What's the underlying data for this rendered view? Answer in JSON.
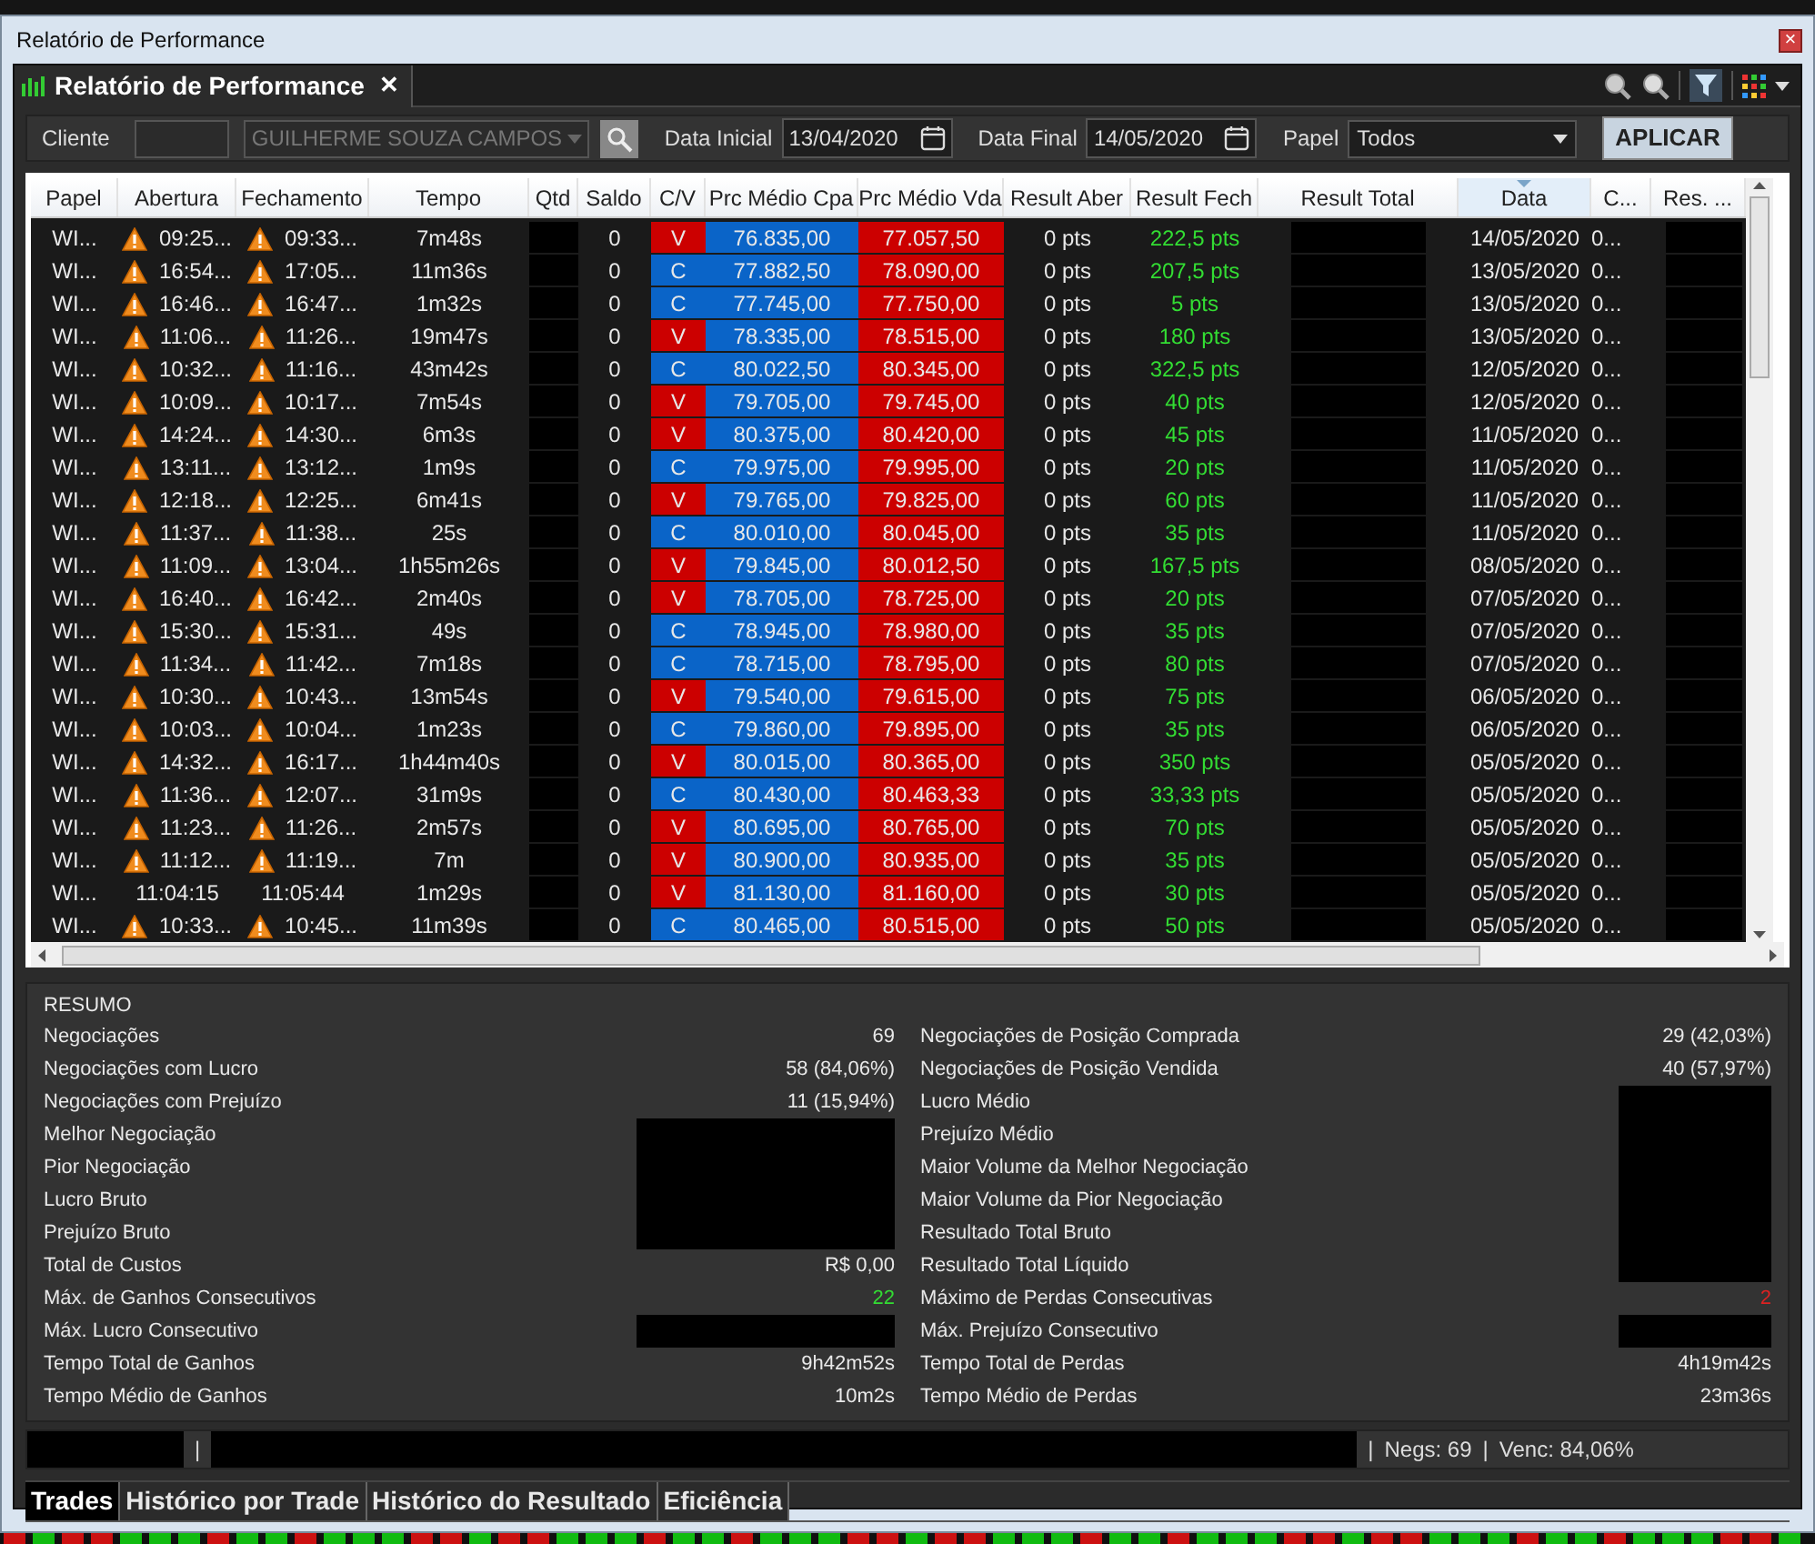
{
  "window": {
    "title": "Relatório de Performance",
    "close": "×"
  },
  "doc_tab": {
    "title": "Relatório de Performance",
    "close": "✕"
  },
  "filters": {
    "cliente_label": "Cliente",
    "cliente_placeholder": "GUILHERME SOUZA CAMPOS",
    "data_inicial_label": "Data Inicial",
    "data_inicial": "13/04/2020",
    "data_final_label": "Data Final",
    "data_final": "14/05/2020",
    "papel_label": "Papel",
    "papel": "Todos",
    "apply": "APLICAR"
  },
  "table": {
    "columns": [
      {
        "label": "Papel",
        "sorted": false
      },
      {
        "label": "Abertura",
        "sorted": false
      },
      {
        "label": "Fechamento",
        "sorted": false
      },
      {
        "label": "Tempo",
        "sorted": false
      },
      {
        "label": "Qtd",
        "sorted": false
      },
      {
        "label": "Saldo",
        "sorted": false
      },
      {
        "label": "C/V",
        "sorted": false
      },
      {
        "label": "Prc Médio Cpa",
        "sorted": false
      },
      {
        "label": "Prc Médio Vda",
        "sorted": false
      },
      {
        "label": "Result Aber",
        "sorted": false
      },
      {
        "label": "Result Fech",
        "sorted": false
      },
      {
        "label": "Result Total",
        "sorted": false
      },
      {
        "label": "Data",
        "sorted": true
      },
      {
        "label": "C...",
        "sorted": false
      },
      {
        "label": "Res. ...",
        "sorted": false
      }
    ],
    "rows": [
      {
        "papel": "WI...",
        "warning": true,
        "abertura": "09:25...",
        "fechamento": "09:33...",
        "tempo": "7m48s",
        "saldo": "0",
        "cv": "V",
        "cpa": "76.835,00",
        "vda": "77.057,50",
        "aber": "0 pts",
        "fech": "222,5 pts",
        "data": "14/05/2020",
        "c": "0..."
      },
      {
        "papel": "WI...",
        "warning": true,
        "abertura": "16:54...",
        "fechamento": "17:05...",
        "tempo": "11m36s",
        "saldo": "0",
        "cv": "C",
        "cpa": "77.882,50",
        "vda": "78.090,00",
        "aber": "0 pts",
        "fech": "207,5 pts",
        "data": "13/05/2020",
        "c": "0..."
      },
      {
        "papel": "WI...",
        "warning": true,
        "abertura": "16:46...",
        "fechamento": "16:47...",
        "tempo": "1m32s",
        "saldo": "0",
        "cv": "C",
        "cpa": "77.745,00",
        "vda": "77.750,00",
        "aber": "0 pts",
        "fech": "5 pts",
        "data": "13/05/2020",
        "c": "0..."
      },
      {
        "papel": "WI...",
        "warning": true,
        "abertura": "11:06...",
        "fechamento": "11:26...",
        "tempo": "19m47s",
        "saldo": "0",
        "cv": "V",
        "cpa": "78.335,00",
        "vda": "78.515,00",
        "aber": "0 pts",
        "fech": "180 pts",
        "data": "13/05/2020",
        "c": "0..."
      },
      {
        "papel": "WI...",
        "warning": true,
        "abertura": "10:32...",
        "fechamento": "11:16...",
        "tempo": "43m42s",
        "saldo": "0",
        "cv": "C",
        "cpa": "80.022,50",
        "vda": "80.345,00",
        "aber": "0 pts",
        "fech": "322,5 pts",
        "data": "12/05/2020",
        "c": "0..."
      },
      {
        "papel": "WI...",
        "warning": true,
        "abertura": "10:09...",
        "fechamento": "10:17...",
        "tempo": "7m54s",
        "saldo": "0",
        "cv": "V",
        "cpa": "79.705,00",
        "vda": "79.745,00",
        "aber": "0 pts",
        "fech": "40 pts",
        "data": "12/05/2020",
        "c": "0..."
      },
      {
        "papel": "WI...",
        "warning": true,
        "abertura": "14:24...",
        "fechamento": "14:30...",
        "tempo": "6m3s",
        "saldo": "0",
        "cv": "V",
        "cpa": "80.375,00",
        "vda": "80.420,00",
        "aber": "0 pts",
        "fech": "45 pts",
        "data": "11/05/2020",
        "c": "0..."
      },
      {
        "papel": "WI...",
        "warning": true,
        "abertura": "13:11...",
        "fechamento": "13:12...",
        "tempo": "1m9s",
        "saldo": "0",
        "cv": "C",
        "cpa": "79.975,00",
        "vda": "79.995,00",
        "aber": "0 pts",
        "fech": "20 pts",
        "data": "11/05/2020",
        "c": "0..."
      },
      {
        "papel": "WI...",
        "warning": true,
        "abertura": "12:18...",
        "fechamento": "12:25...",
        "tempo": "6m41s",
        "saldo": "0",
        "cv": "V",
        "cpa": "79.765,00",
        "vda": "79.825,00",
        "aber": "0 pts",
        "fech": "60 pts",
        "data": "11/05/2020",
        "c": "0..."
      },
      {
        "papel": "WI...",
        "warning": true,
        "abertura": "11:37...",
        "fechamento": "11:38...",
        "tempo": "25s",
        "saldo": "0",
        "cv": "C",
        "cpa": "80.010,00",
        "vda": "80.045,00",
        "aber": "0 pts",
        "fech": "35 pts",
        "data": "11/05/2020",
        "c": "0..."
      },
      {
        "papel": "WI...",
        "warning": true,
        "abertura": "11:09...",
        "fechamento": "13:04...",
        "tempo": "1h55m26s",
        "saldo": "0",
        "cv": "V",
        "cpa": "79.845,00",
        "vda": "80.012,50",
        "aber": "0 pts",
        "fech": "167,5 pts",
        "data": "08/05/2020",
        "c": "0..."
      },
      {
        "papel": "WI...",
        "warning": true,
        "abertura": "16:40...",
        "fechamento": "16:42...",
        "tempo": "2m40s",
        "saldo": "0",
        "cv": "V",
        "cpa": "78.705,00",
        "vda": "78.725,00",
        "aber": "0 pts",
        "fech": "20 pts",
        "data": "07/05/2020",
        "c": "0..."
      },
      {
        "papel": "WI...",
        "warning": true,
        "abertura": "15:30...",
        "fechamento": "15:31...",
        "tempo": "49s",
        "saldo": "0",
        "cv": "C",
        "cpa": "78.945,00",
        "vda": "78.980,00",
        "aber": "0 pts",
        "fech": "35 pts",
        "data": "07/05/2020",
        "c": "0..."
      },
      {
        "papel": "WI...",
        "warning": true,
        "abertura": "11:34...",
        "fechamento": "11:42...",
        "tempo": "7m18s",
        "saldo": "0",
        "cv": "C",
        "cpa": "78.715,00",
        "vda": "78.795,00",
        "aber": "0 pts",
        "fech": "80 pts",
        "data": "07/05/2020",
        "c": "0..."
      },
      {
        "papel": "WI...",
        "warning": true,
        "abertura": "10:30...",
        "fechamento": "10:43...",
        "tempo": "13m54s",
        "saldo": "0",
        "cv": "V",
        "cpa": "79.540,00",
        "vda": "79.615,00",
        "aber": "0 pts",
        "fech": "75 pts",
        "data": "06/05/2020",
        "c": "0..."
      },
      {
        "papel": "WI...",
        "warning": true,
        "abertura": "10:03...",
        "fechamento": "10:04...",
        "tempo": "1m23s",
        "saldo": "0",
        "cv": "C",
        "cpa": "79.860,00",
        "vda": "79.895,00",
        "aber": "0 pts",
        "fech": "35 pts",
        "data": "06/05/2020",
        "c": "0..."
      },
      {
        "papel": "WI...",
        "warning": true,
        "abertura": "14:32...",
        "fechamento": "16:17...",
        "tempo": "1h44m40s",
        "saldo": "0",
        "cv": "V",
        "cpa": "80.015,00",
        "vda": "80.365,00",
        "aber": "0 pts",
        "fech": "350 pts",
        "data": "05/05/2020",
        "c": "0..."
      },
      {
        "papel": "WI...",
        "warning": true,
        "abertura": "11:36...",
        "fechamento": "12:07...",
        "tempo": "31m9s",
        "saldo": "0",
        "cv": "C",
        "cpa": "80.430,00",
        "vda": "80.463,33",
        "aber": "0 pts",
        "fech": "33,33 pts",
        "data": "05/05/2020",
        "c": "0..."
      },
      {
        "papel": "WI...",
        "warning": true,
        "abertura": "11:23...",
        "fechamento": "11:26...",
        "tempo": "2m57s",
        "saldo": "0",
        "cv": "V",
        "cpa": "80.695,00",
        "vda": "80.765,00",
        "aber": "0 pts",
        "fech": "70 pts",
        "data": "05/05/2020",
        "c": "0..."
      },
      {
        "papel": "WI...",
        "warning": true,
        "abertura": "11:12...",
        "fechamento": "11:19...",
        "tempo": "7m",
        "saldo": "0",
        "cv": "V",
        "cpa": "80.900,00",
        "vda": "80.935,00",
        "aber": "0 pts",
        "fech": "35 pts",
        "data": "05/05/2020",
        "c": "0..."
      },
      {
        "papel": "WI...",
        "warning": false,
        "abertura": "11:04:15",
        "fechamento": "11:05:44",
        "tempo": "1m29s",
        "saldo": "0",
        "cv": "V",
        "cpa": "81.130,00",
        "vda": "81.160,00",
        "aber": "0 pts",
        "fech": "30 pts",
        "data": "05/05/2020",
        "c": "0..."
      },
      {
        "papel": "WI...",
        "warning": true,
        "abertura": "10:33...",
        "fechamento": "10:45...",
        "tempo": "11m39s",
        "saldo": "0",
        "cv": "C",
        "cpa": "80.465,00",
        "vda": "80.515,00",
        "aber": "0 pts",
        "fech": "50 pts",
        "data": "05/05/2020",
        "c": "0..."
      }
    ]
  },
  "summary": {
    "title": "RESUMO",
    "left": [
      {
        "label": "Negociações",
        "value": "69"
      },
      {
        "label": "Negociações com Lucro",
        "value": "58 (84,06%)"
      },
      {
        "label": "Negociações com Prejuízo",
        "value": "11 (15,94%)"
      },
      {
        "label": "Melhor Negociação",
        "redacted": true
      },
      {
        "label": "Pior Negociação",
        "redacted": true
      },
      {
        "label": "Lucro Bruto",
        "redacted": true
      },
      {
        "label": "Prejuízo Bruto",
        "redacted": true
      },
      {
        "label": "Total de Custos",
        "value": "R$ 0,00"
      },
      {
        "label": "Máx. de Ganhos Consecutivos",
        "value": "22",
        "color": "#33dd33"
      },
      {
        "label": "Máx. Lucro Consecutivo",
        "redacted": true
      },
      {
        "label": "Tempo Total de Ganhos",
        "value": "9h42m52s"
      },
      {
        "label": "Tempo Médio de Ganhos",
        "value": "10m2s"
      }
    ],
    "right": [
      {
        "label": "Negociações de Posição Comprada",
        "value": "29 (42,03%)"
      },
      {
        "label": "Negociações de Posição Vendida",
        "value": "40 (57,97%)"
      },
      {
        "label": "Lucro Médio",
        "redacted": true
      },
      {
        "label": "Prejuízo Médio",
        "redacted": true
      },
      {
        "label": "Maior Volume da Melhor Negociação",
        "redacted": true
      },
      {
        "label": "Maior Volume da Pior Negociação",
        "redacted": true
      },
      {
        "label": "Resultado Total Bruto",
        "redacted": true
      },
      {
        "label": "Resultado Total Líquido",
        "redacted": true
      },
      {
        "label": "Máximo de Perdas Consecutivas",
        "value": "2",
        "color": "#dd2222"
      },
      {
        "label": "Máx. Prejuízo Consecutivo",
        "redacted": true
      },
      {
        "label": "Tempo Total de Perdas",
        "value": "4h19m42s"
      },
      {
        "label": "Tempo Médio de Perdas",
        "value": "23m36s"
      }
    ]
  },
  "status_bar": [
    {
      "kind": "redacted"
    },
    {
      "kind": "text",
      "text": "|"
    },
    {
      "kind": "wideredacted"
    },
    {
      "kind": "text",
      "text": "|"
    },
    {
      "kind": "text",
      "text": "Negs: 69"
    },
    {
      "kind": "text",
      "text": "|"
    },
    {
      "kind": "text",
      "text": "Venc: 84,06%"
    }
  ],
  "bottom_tabs": [
    {
      "label": "Trades",
      "selected": true
    },
    {
      "label": "Histórico por Trade",
      "selected": false
    },
    {
      "label": "Histórico do Resultado",
      "selected": false
    },
    {
      "label": "Eficiência",
      "selected": false
    }
  ]
}
